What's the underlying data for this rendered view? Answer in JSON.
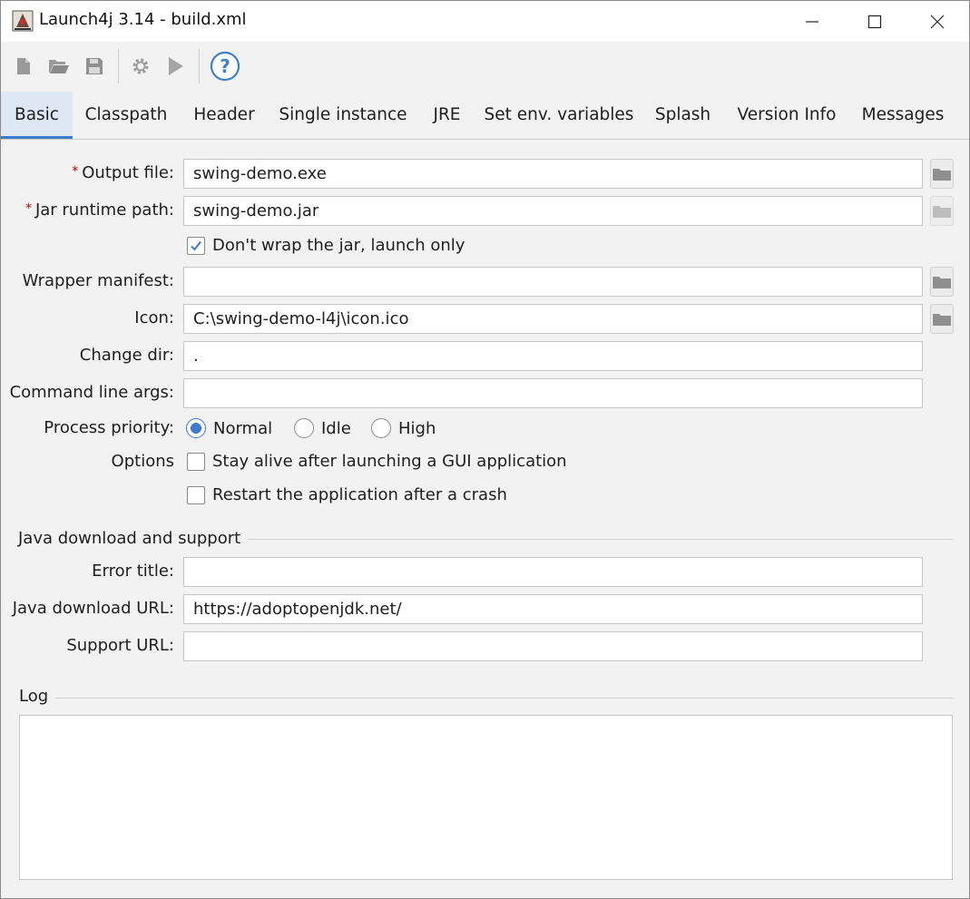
{
  "window": {
    "title": "Launch4j 3.14 - build.xml"
  },
  "toolbar": {
    "buttons": [
      {
        "icon": "new-file-icon"
      },
      {
        "icon": "open-folder-icon"
      },
      {
        "icon": "save-icon"
      },
      {
        "icon": "build-gear-icon"
      },
      {
        "icon": "run-icon"
      },
      {
        "icon": "help-icon"
      }
    ]
  },
  "tabs": [
    {
      "label": "Basic",
      "active": true
    },
    {
      "label": "Classpath"
    },
    {
      "label": "Header"
    },
    {
      "label": "Single instance"
    },
    {
      "label": "JRE"
    },
    {
      "label": "Set env. variables"
    },
    {
      "label": "Splash"
    },
    {
      "label": "Version Info"
    },
    {
      "label": "Messages"
    }
  ],
  "basic": {
    "required_mark": "*",
    "output_file": {
      "label": "Output file:",
      "value": "swing-demo.exe"
    },
    "jar_runtime_path": {
      "label": "Jar runtime path:",
      "value": "swing-demo.jar"
    },
    "dont_wrap": {
      "label": "Don't wrap the jar, launch only",
      "checked": true
    },
    "wrapper_manifest": {
      "label": "Wrapper manifest:",
      "value": ""
    },
    "icon": {
      "label": "Icon:",
      "value": "C:\\swing-demo-l4j\\icon.ico"
    },
    "change_dir": {
      "label": "Change dir:",
      "value": "."
    },
    "command_line_args": {
      "label": "Command line args:",
      "value": ""
    },
    "process_priority": {
      "label": "Process priority:",
      "options": [
        "Normal",
        "Idle",
        "High"
      ],
      "selected": "Normal"
    },
    "options": {
      "label": "Options",
      "stay_alive": {
        "label": "Stay alive after launching a GUI application",
        "checked": false
      },
      "restart_on_crash": {
        "label": "Restart the application after a crash",
        "checked": false
      }
    }
  },
  "java_download": {
    "section_title": "Java download and support",
    "error_title": {
      "label": "Error title:",
      "value": ""
    },
    "java_download_url": {
      "label": "Java download URL:",
      "value": "https://adoptopenjdk.net/"
    },
    "support_url": {
      "label": "Support URL:",
      "value": ""
    }
  },
  "log": {
    "section_title": "Log",
    "content": ""
  },
  "colors": {
    "accent": "#3d7cc9",
    "required": "#d00000",
    "background": "#f2f2f2"
  }
}
